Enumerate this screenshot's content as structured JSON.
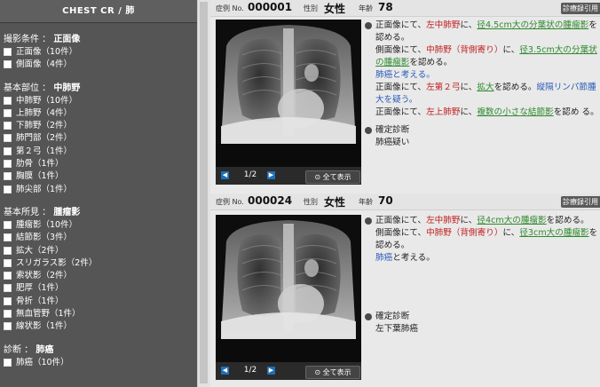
{
  "sidebar": {
    "title": "CHEST CR / 肺",
    "groups": [
      {
        "title": "撮影条件 ：",
        "selected": "正面像",
        "items": [
          "正面像（10件）",
          "側面像（4件）"
        ]
      },
      {
        "title": "基本部位 ：",
        "selected": "中肺野",
        "items": [
          "中肺野（10件）",
          "上肺野（4件）",
          "下肺野（2件）",
          "肺門部（2件）",
          "第２弓（1件）",
          "肋骨（1件）",
          "胸膜（1件）",
          "肺尖部（1件）"
        ]
      },
      {
        "title": "基本所見 ：",
        "selected": "腫瘤影",
        "items": [
          "腫瘤影（10件）",
          "結節影（3件）",
          "拡大（2件）",
          "スリガラス影（2件）",
          "索状影（2件）",
          "肥厚（1件）",
          "骨折（1件）",
          "無血管野（1件）",
          "線状影（1件）"
        ]
      },
      {
        "title": "診断 ：",
        "selected": "肺癌",
        "items": [
          "肺癌（10件）"
        ]
      }
    ]
  },
  "cases": [
    {
      "case_label": "症例 No.",
      "case_no": "000001",
      "sex_label": "性別",
      "sex": "女性",
      "age_label": "年齢",
      "age": "78",
      "link_label": "診療録引用",
      "page": "1/2",
      "show_all": "全て表示",
      "findings": [
        {
          "segments": [
            {
              "t": "正面像にて、",
              "c": ""
            },
            {
              "t": "左中肺野",
              "c": "red"
            },
            {
              "t": "に、",
              "c": ""
            },
            {
              "t": "径4.5cm大の分葉状の腫瘤影",
              "c": "green"
            },
            {
              "t": "を認める。",
              "c": ""
            }
          ]
        },
        {
          "segments": [
            {
              "t": "側面像にて、",
              "c": ""
            },
            {
              "t": "中肺野（背側寄り）",
              "c": "red"
            },
            {
              "t": "に、",
              "c": ""
            },
            {
              "t": "径3.5cm大の分葉状の腫瘤影",
              "c": "green"
            },
            {
              "t": "を認める。",
              "c": ""
            }
          ]
        },
        {
          "segments": [
            {
              "t": "肺癌と考える。",
              "c": "blue"
            }
          ]
        },
        {
          "segments": [
            {
              "t": "正面像にて、",
              "c": ""
            },
            {
              "t": "左第２弓",
              "c": "red"
            },
            {
              "t": "に、",
              "c": ""
            },
            {
              "t": "拡大",
              "c": "green"
            },
            {
              "t": "を認める。",
              "c": ""
            },
            {
              "t": "縦隔リンパ節腫大を疑う。",
              "c": "blue"
            }
          ]
        },
        {
          "segments": [
            {
              "t": "正面像にて、",
              "c": ""
            },
            {
              "t": "左上肺野",
              "c": "red"
            },
            {
              "t": "に、",
              "c": ""
            },
            {
              "t": "複数の小さな結節影",
              "c": "green"
            },
            {
              "t": "を認め る。",
              "c": ""
            }
          ]
        }
      ],
      "diag_label": "確定診断",
      "diagnosis": "肺癌疑い"
    },
    {
      "case_label": "症例 No.",
      "case_no": "000024",
      "sex_label": "性別",
      "sex": "女性",
      "age_label": "年齢",
      "age": "70",
      "link_label": "診療録引用",
      "page": "1/2",
      "show_all": "全て表示",
      "findings": [
        {
          "segments": [
            {
              "t": "正面像にて、",
              "c": ""
            },
            {
              "t": "左中肺野",
              "c": "red"
            },
            {
              "t": "に、",
              "c": ""
            },
            {
              "t": "径4cm大の腫瘤影",
              "c": "green"
            },
            {
              "t": "を認める。",
              "c": ""
            }
          ]
        },
        {
          "segments": [
            {
              "t": "側面像にて、",
              "c": ""
            },
            {
              "t": "中肺野（背側寄り）",
              "c": "red"
            },
            {
              "t": "に、",
              "c": ""
            },
            {
              "t": "径3cm大の腫瘤影",
              "c": "green"
            },
            {
              "t": "を認める。",
              "c": ""
            }
          ]
        },
        {
          "segments": [
            {
              "t": "肺癌",
              "c": "blue"
            },
            {
              "t": "と考える。",
              "c": ""
            }
          ]
        }
      ],
      "diag_label": "確定診断",
      "diagnosis": "左下葉肺癌"
    }
  ],
  "colors": {
    "sidebar_bg": "#555555",
    "location": "#c02020",
    "finding": "#2f8a2f",
    "diagnosis_link": "#2a5cb8",
    "nav_button": "#1e6fb5"
  }
}
